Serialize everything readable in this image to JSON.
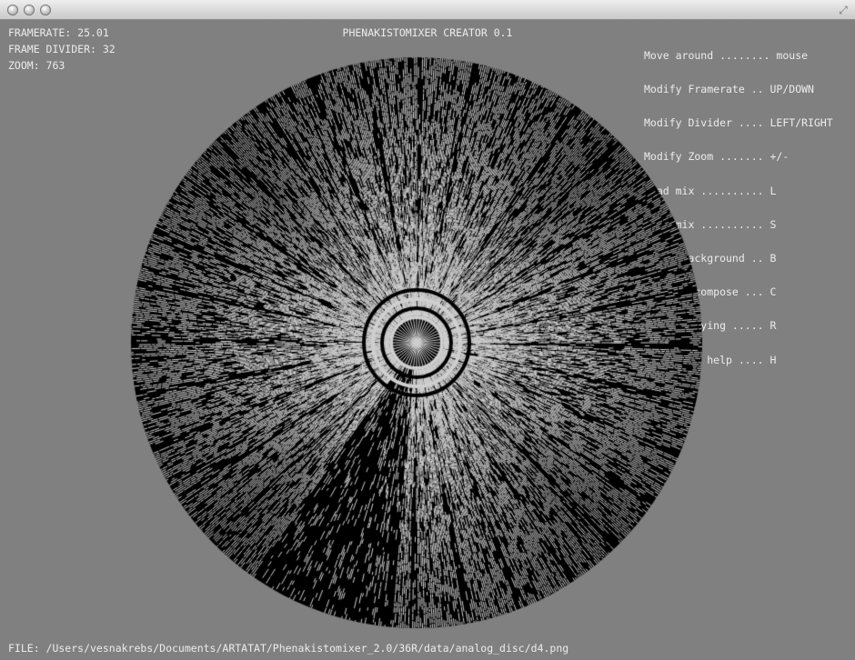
{
  "window": {
    "buttons": [
      "close-button",
      "minimize-button",
      "zoom-button"
    ]
  },
  "app": {
    "title": "PHENAKISTOMIXER CREATOR 0.1"
  },
  "stats": {
    "framerate": "FRAMERATE: 25.01",
    "frame_divider": "FRAME DIVIDER: 32",
    "zoom": "ZOOM: 763"
  },
  "help": [
    {
      "action": "Move around ........",
      "key": "mouse"
    },
    {
      "action": "Modify Framerate ..",
      "key": "UP/DOWN"
    },
    {
      "action": "Modify Divider ....",
      "key": "LEFT/RIGHT"
    },
    {
      "action": "Modify Zoom .......",
      "key": "+/-"
    },
    {
      "action": "Load mix ..........",
      "key": "L"
    },
    {
      "action": "Save mix ..........",
      "key": "S"
    },
    {
      "action": "Cycle background ..",
      "key": "B"
    },
    {
      "action": "Reverse compose ...",
      "key": "C"
    },
    {
      "action": "Reset playing .....",
      "key": "R"
    },
    {
      "action": "Show/hide help ....",
      "key": "H"
    }
  ],
  "file": {
    "path": "FILE: /Users/vesnakrebs/Documents/ARTATAT/Phenakistomixer_2.0/36R/data/analog_disc/d4.png"
  },
  "disc": {
    "segments": 32,
    "dark_wedge_angles_deg": [
      95,
      125
    ]
  },
  "colors": {
    "background": "#808080",
    "text": "#ececec",
    "disc_dark": "#000000",
    "disc_light": "#cfcfcf"
  }
}
